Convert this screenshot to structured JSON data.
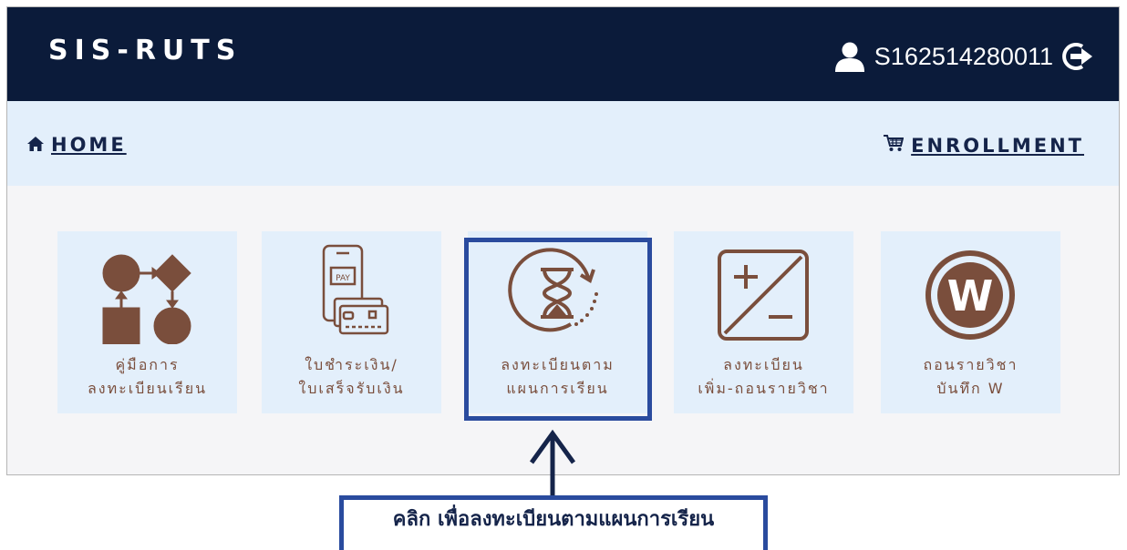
{
  "header": {
    "brand": "SIS-RUTS",
    "user_id": "S162514280011",
    "user_icon": "user-icon",
    "logout_icon": "logout-icon"
  },
  "nav": {
    "home_label": "HOME",
    "home_icon": "home-icon",
    "enroll_label": "ENROLLMENT",
    "enroll_icon": "cart-icon"
  },
  "tiles": [
    {
      "line1": "คู่มือการ",
      "line2": "ลงทะเบียนเรียน",
      "icon": "flowchart-icon"
    },
    {
      "line1": "ใบชำระเงิน/",
      "line2": "ใบเสร็จรับเงิน",
      "icon": "payment-phone-icon"
    },
    {
      "line1": "ลงทะเบียนตาม",
      "line2": "แผนการเรียน",
      "icon": "hourglass-clock-icon"
    },
    {
      "line1": "ลงทะเบียน",
      "line2": "เพิ่ม-ถอนรายวิชา",
      "icon": "plus-minus-icon"
    },
    {
      "line1": "ถอนรายวิชา",
      "line2": "บันทึก W",
      "icon": "w-circle-icon"
    }
  ],
  "callout": {
    "text": "คลิก เพื่อลงทะเบียนตามแผนการเรียน"
  },
  "colors": {
    "header_bg": "#0b1b3a",
    "nav_bg": "#e3effb",
    "icon_brown": "#7a4e3c",
    "highlight_blue": "#2a4b9e"
  }
}
